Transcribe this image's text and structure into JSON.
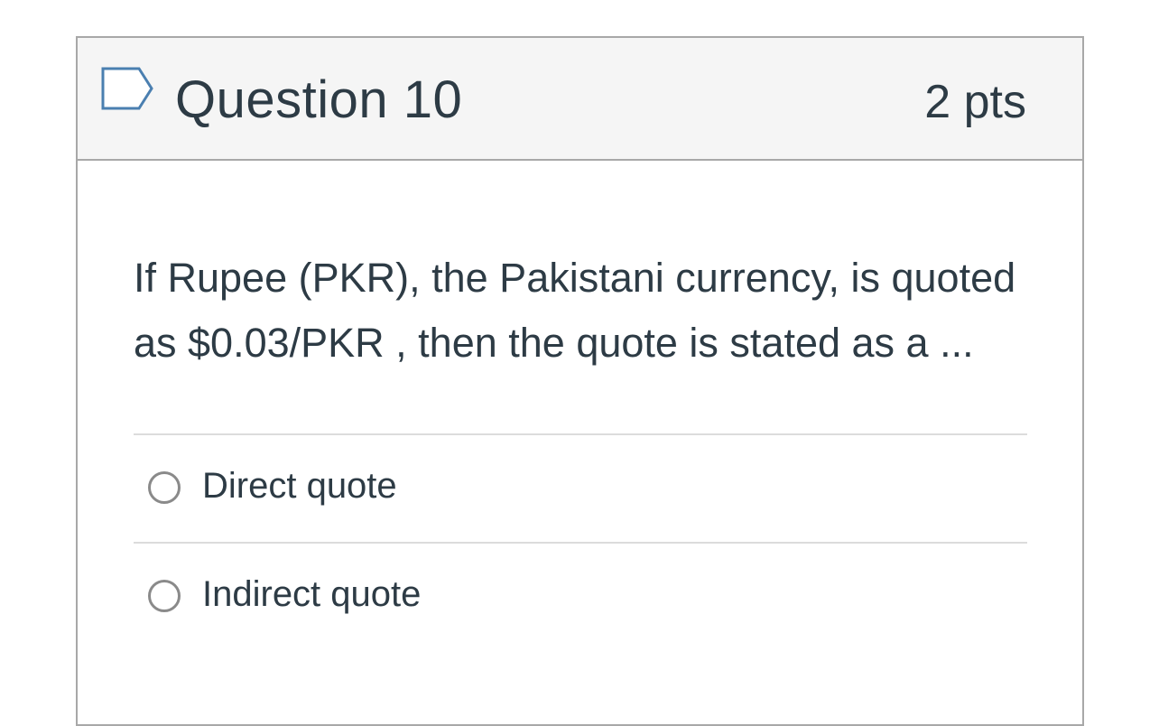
{
  "question": {
    "title": "Question 10",
    "points": "2 pts",
    "flag_icon": "bookmark-flag-icon",
    "text": "If Rupee (PKR), the Pakistani currency, is quoted as $0.03/PKR , then the quote is stated as a ..."
  },
  "answers": [
    {
      "label": "Direct quote",
      "selected": false
    },
    {
      "label": "Indirect quote",
      "selected": false
    }
  ],
  "colors": {
    "text": "#2d3b45",
    "header_bg": "#f5f5f5",
    "border": "#a8a8a8",
    "flag_stroke": "#4a7fb0"
  }
}
